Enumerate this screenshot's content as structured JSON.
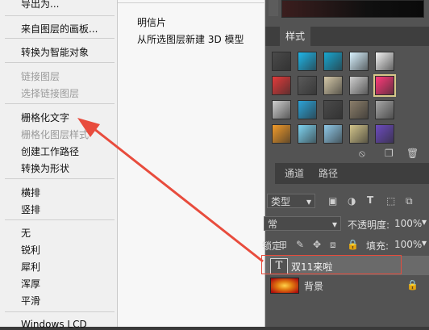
{
  "menu": {
    "items": [
      {
        "label": "导出为...",
        "enabled": true
      },
      {
        "label": "来自图层的画板...",
        "enabled": true
      },
      {
        "label": "转换为智能对象",
        "enabled": true
      },
      {
        "label": "链接图层",
        "enabled": false
      },
      {
        "label": "选择链接图层",
        "enabled": false
      },
      {
        "label": "栅格化文字",
        "enabled": true
      },
      {
        "label": "栅格化图层样式",
        "enabled": false
      },
      {
        "label": "创建工作路径",
        "enabled": true
      },
      {
        "label": "转换为形状",
        "enabled": true
      },
      {
        "label": "横排",
        "enabled": true
      },
      {
        "label": "竖排",
        "enabled": true
      },
      {
        "label": "无",
        "enabled": true
      },
      {
        "label": "锐利",
        "enabled": true
      },
      {
        "label": "犀利",
        "enabled": true
      },
      {
        "label": "浑厚",
        "enabled": true
      },
      {
        "label": "平滑",
        "enabled": true
      },
      {
        "label": "Windows LCD",
        "enabled": true
      }
    ]
  },
  "submenu": {
    "items": [
      {
        "label": "明信片"
      },
      {
        "label": "从所选图层新建 3D 模型"
      }
    ]
  },
  "styles_panel": {
    "tab_label": "样式",
    "colors": {
      "swatches": [
        "#4a4a4a",
        "#1fb6e8",
        "#19a7d0",
        "#d8f2ff",
        "#f2f2f2",
        "#e33b3b",
        "#5a5a5a",
        "#d4c8a8",
        "#cfcfcf",
        "#ff3a7a",
        "#cfcfcf",
        "#2ca3d8",
        "#4a4a4a",
        "#8b7e6a",
        "#a7a7a7",
        "#f29b2a",
        "#7dd3f0",
        "#8fc9e8",
        "#d2c48a",
        "#6c4bbf"
      ]
    }
  },
  "layers_panel": {
    "tabs": [
      "通道",
      "路径"
    ],
    "kind_label": "类型",
    "blend_mode": "常",
    "opacity_label": "不透明度:",
    "opacity_value": "100%",
    "lock_label": "锁定:",
    "fill_label": "填充:",
    "fill_value": "100%",
    "layers": [
      {
        "name": "双11来啦",
        "type": "text",
        "selected": true
      },
      {
        "name": "背景",
        "type": "image",
        "locked": true
      }
    ]
  },
  "annotation": {
    "arrow_color": "#e84c3d",
    "highlight_color": "#e74c3c"
  }
}
